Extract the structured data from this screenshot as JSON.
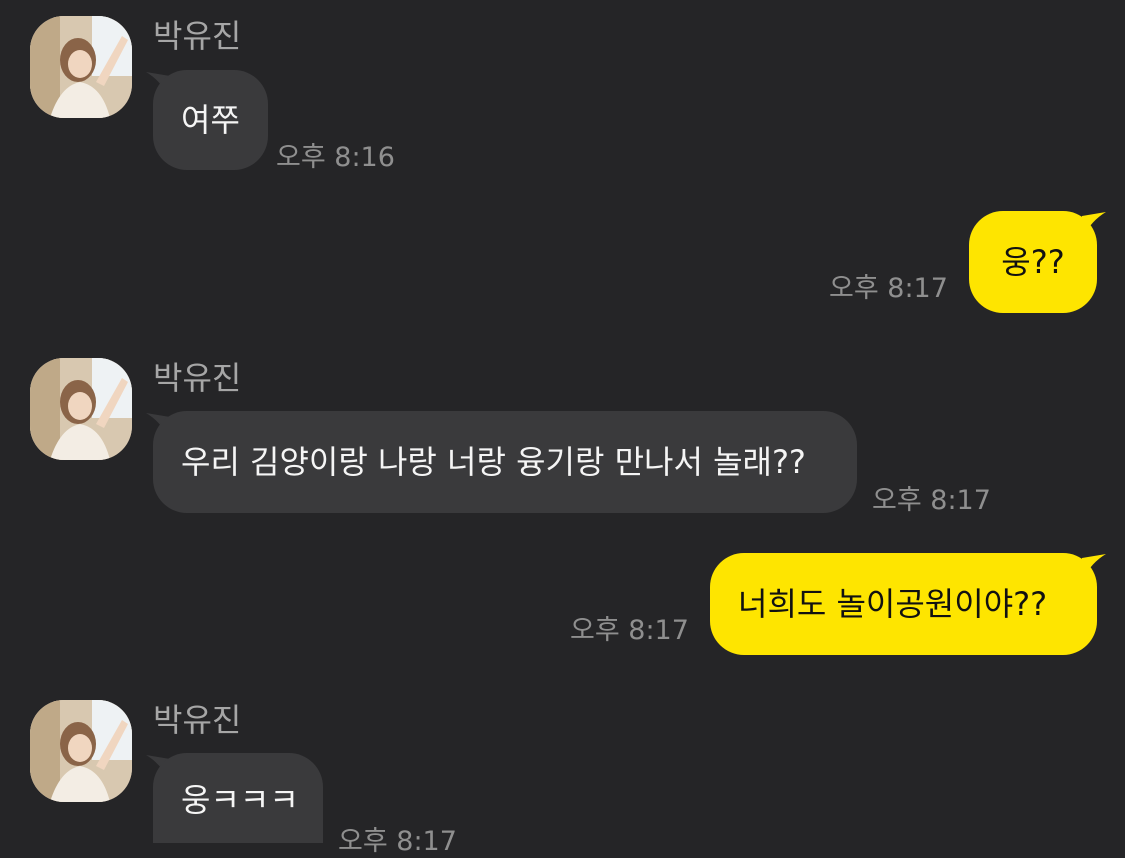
{
  "chat": {
    "colors": {
      "background": "#252527",
      "incoming_bubble": "#3a3a3c",
      "outgoing_bubble": "#fee500"
    },
    "messages": [
      {
        "direction": "incoming",
        "sender": "박유진",
        "text": "여쭈",
        "time": "오후 8:16"
      },
      {
        "direction": "outgoing",
        "text": "웅??",
        "time": "오후 8:17"
      },
      {
        "direction": "incoming",
        "sender": "박유진",
        "text": "우리 김양이랑 나랑 너랑 융기랑 만나서 놀래??",
        "time": "오후 8:17"
      },
      {
        "direction": "outgoing",
        "text": "너희도 놀이공원이야??",
        "time": "오후 8:17"
      },
      {
        "direction": "incoming",
        "sender": "박유진",
        "text": "웅ㅋㅋㅋ",
        "time": "오후 8:17"
      }
    ]
  }
}
